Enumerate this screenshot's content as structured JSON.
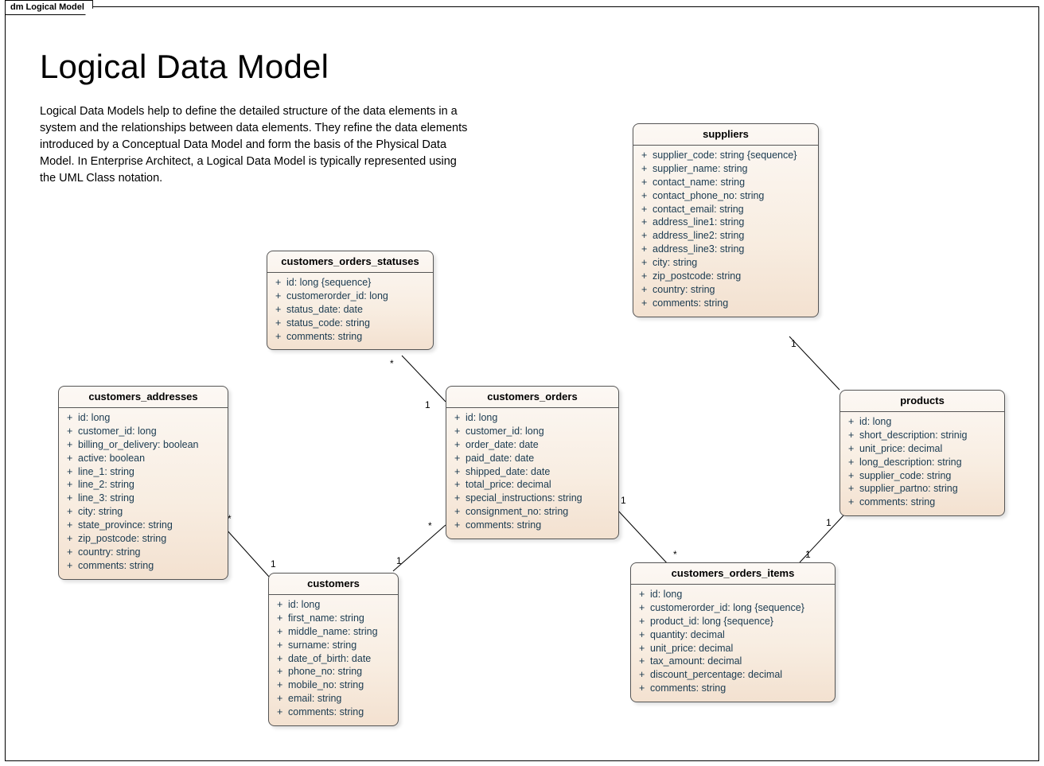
{
  "frame_label": "dm Logical Model",
  "title": "Logical Data Model",
  "description": "Logical Data Models help to define the detailed structure of the data elements in a system and the relationships between data elements. They refine the data elements introduced by a Conceptual Data Model and form the basis of the Physical Data Model. In Enterprise Architect, a Logical Data Model is typically represented using the UML Class notation.",
  "entities": {
    "customers_orders_statuses": {
      "title": "customers_orders_statuses",
      "attrs": [
        "id: long {sequence}",
        "customerorder_id: long",
        "status_date: date",
        "status_code: string",
        "comments: string"
      ]
    },
    "customers_addresses": {
      "title": "customers_addresses",
      "attrs": [
        "id: long",
        "customer_id: long",
        "billing_or_delivery: boolean",
        "active: boolean",
        "line_1: string",
        "line_2: string",
        "line_3: string",
        "city: string",
        "state_province: string",
        "zip_postcode: string",
        "country: string",
        "comments: string"
      ]
    },
    "customers_orders": {
      "title": "customers_orders",
      "attrs": [
        "id: long",
        "customer_id: long",
        "order_date: date",
        "paid_date: date",
        "shipped_date: date",
        "total_price: decimal",
        "special_instructions: string",
        "consignment_no: string",
        "comments: string"
      ]
    },
    "suppliers": {
      "title": "suppliers",
      "attrs": [
        "supplier_code: string {sequence}",
        "supplier_name: string",
        "contact_name: string",
        "contact_phone_no: string",
        "contact_email: string",
        "address_line1: string",
        "address_line2: string",
        "address_line3: string",
        "city: string",
        "zip_postcode: string",
        "country: string",
        "comments: string"
      ]
    },
    "products": {
      "title": "products",
      "attrs": [
        "id: long",
        "short_description: strinig",
        "unit_price: decimal",
        "long_description: string",
        "supplier_code: string",
        "supplier_partno: string",
        "comments: string"
      ]
    },
    "customers": {
      "title": "customers",
      "attrs": [
        "id: long",
        "first_name: string",
        "middle_name: string",
        "surname: string",
        "date_of_birth: date",
        "phone_no: string",
        "mobile_no: string",
        "email: string",
        "comments: string"
      ]
    },
    "customers_orders_items": {
      "title": "customers_orders_items",
      "attrs": [
        "id: long",
        "customerorder_id: long {sequence}",
        "product_id: long {sequence}",
        "quantity: decimal",
        "unit_price: decimal",
        "tax_amount: decimal",
        "discount_percentage: decimal",
        "comments: string"
      ]
    }
  },
  "multiplicities": {
    "statuses_star": "*",
    "orders_to_statuses_1": "1",
    "addresses_star": "*",
    "customers_to_addresses_1": "1",
    "orders_star": "*",
    "customers_to_orders_1": "1",
    "orders_to_items_1": "1",
    "items_star": "*",
    "items_to_products_1": "1",
    "products_to_items_1": "1",
    "suppliers_to_products_1": "1"
  }
}
